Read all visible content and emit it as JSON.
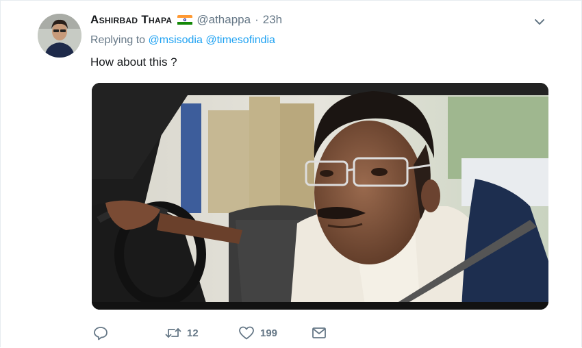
{
  "tweet": {
    "fullname": "Ashirbad Thapa",
    "username": "@athappa",
    "separator": "·",
    "time": "23h",
    "replying_prefix": "Replying to",
    "replying_to": [
      "@msisodia",
      "@timesofindia"
    ],
    "text": "How about this ?"
  },
  "actions": {
    "reply_icon": "reply-icon",
    "retweet_icon": "retweet-icon",
    "retweet_count": "12",
    "like_icon": "heart-icon",
    "like_count": "199",
    "dm_icon": "envelope-icon"
  },
  "colors": {
    "link": "#1da1f2",
    "secondary_text": "#657786",
    "primary_text": "#14171a"
  }
}
